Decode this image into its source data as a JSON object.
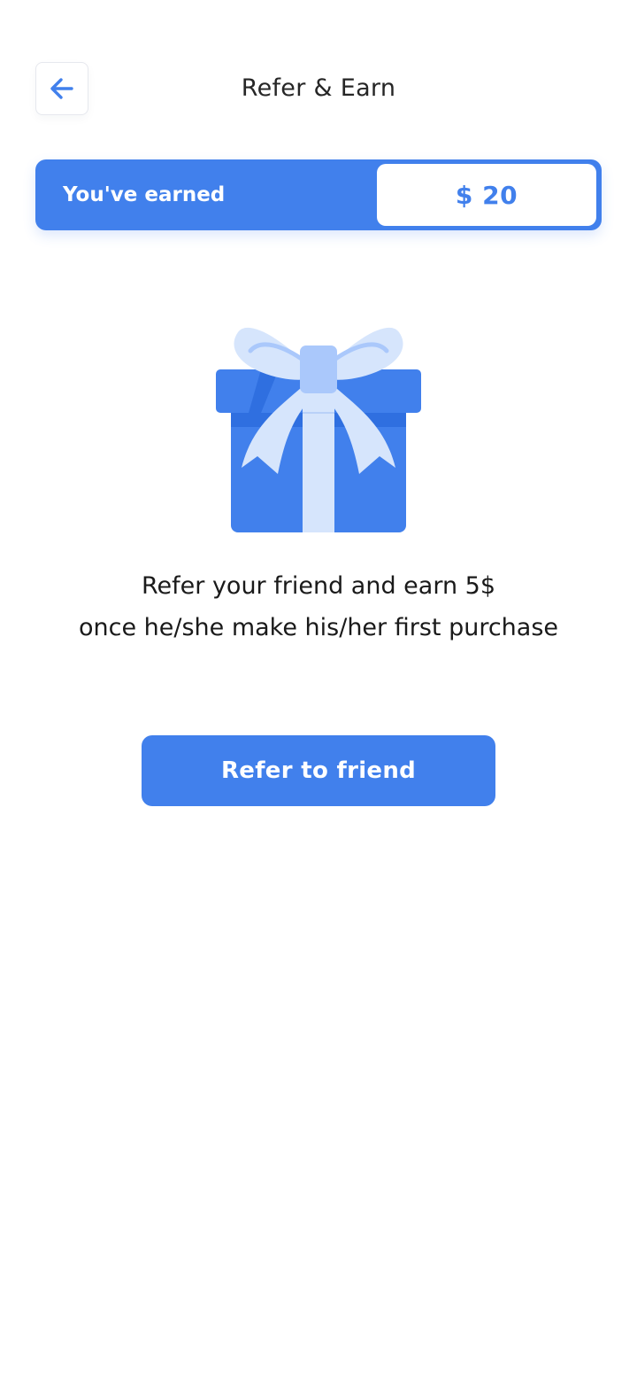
{
  "header": {
    "title": "Refer & Earn",
    "back_icon": "arrow-left-icon"
  },
  "earnings": {
    "label": "You've earned",
    "value": "$ 20"
  },
  "illustration": {
    "icon": "gift-box-icon"
  },
  "message": {
    "line1": "Refer your friend and earn 5$",
    "line2": "once he/she make his/her first purchase"
  },
  "actions": {
    "refer_label": "Refer to friend"
  },
  "colors": {
    "accent": "#4180ec",
    "ribbon_light": "#d6e5fc",
    "ribbon_mid": "#aac8fb",
    "box_dark": "#2f6fe0"
  }
}
